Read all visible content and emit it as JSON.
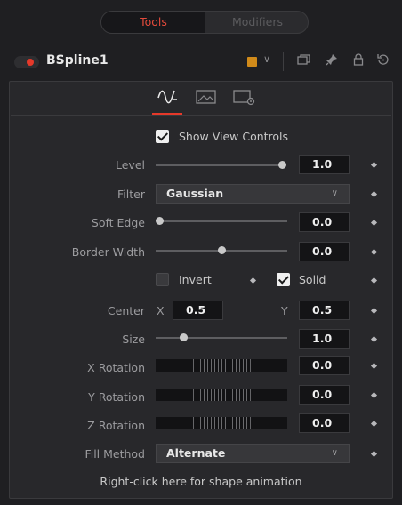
{
  "tabs": {
    "tools": "Tools",
    "modifiers": "Modifiers"
  },
  "header": {
    "tool_name": "BSpline1",
    "swatch_color": "#d08a1a",
    "active_color": "#e6392a"
  },
  "panel_tabs": [
    {
      "icon": "controls-wave-icon",
      "selected": true
    },
    {
      "icon": "image-icon",
      "selected": false
    },
    {
      "icon": "settings-panel-icon",
      "selected": false
    }
  ],
  "show_view_controls": {
    "label": "Show View Controls",
    "checked": true
  },
  "level": {
    "label": "Level",
    "value": "1.0",
    "slider": 1.0
  },
  "filter": {
    "label": "Filter",
    "value": "Gaussian"
  },
  "soft_edge": {
    "label": "Soft Edge",
    "value": "0.0",
    "slider": 0.0
  },
  "border_width": {
    "label": "Border Width",
    "value": "0.0",
    "slider": 0.5
  },
  "invert": {
    "label": "Invert",
    "checked": false
  },
  "solid": {
    "label": "Solid",
    "checked": true
  },
  "center": {
    "label": "Center",
    "x_label": "X",
    "x_value": "0.5",
    "y_label": "Y",
    "y_value": "0.5"
  },
  "size": {
    "label": "Size",
    "value": "1.0",
    "slider": 0.2
  },
  "x_rotation": {
    "label": "X Rotation",
    "value": "0.0"
  },
  "y_rotation": {
    "label": "Y Rotation",
    "value": "0.0"
  },
  "z_rotation": {
    "label": "Z Rotation",
    "value": "0.0"
  },
  "fill_method": {
    "label": "Fill Method",
    "value": "Alternate"
  },
  "footer": "Right-click here for shape animation"
}
